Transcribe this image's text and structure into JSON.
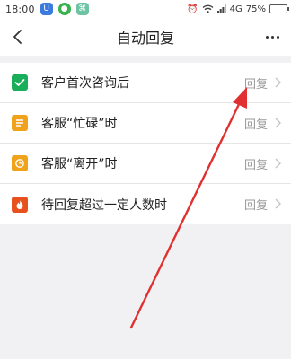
{
  "status_bar": {
    "time": "18:00",
    "network": "4G",
    "battery": "75%",
    "battery_level": 0.75
  },
  "header": {
    "title": "自动回复"
  },
  "list": {
    "items": [
      {
        "label": "客户首次咨询后",
        "status": "回复",
        "icon": "check-icon",
        "color": "#1aad5a"
      },
      {
        "label": "客服“忙碌”时",
        "status": "回复",
        "icon": "lines-icon",
        "color": "#f0a21b"
      },
      {
        "label": "客服“离开”时",
        "status": "回复",
        "icon": "clock-icon",
        "color": "#f0a21b"
      },
      {
        "label": "待回复超过一定人数时",
        "status": "回复",
        "icon": "flame-icon",
        "color": "#e8501e"
      }
    ]
  },
  "annotation": {
    "color": "#e03030"
  }
}
